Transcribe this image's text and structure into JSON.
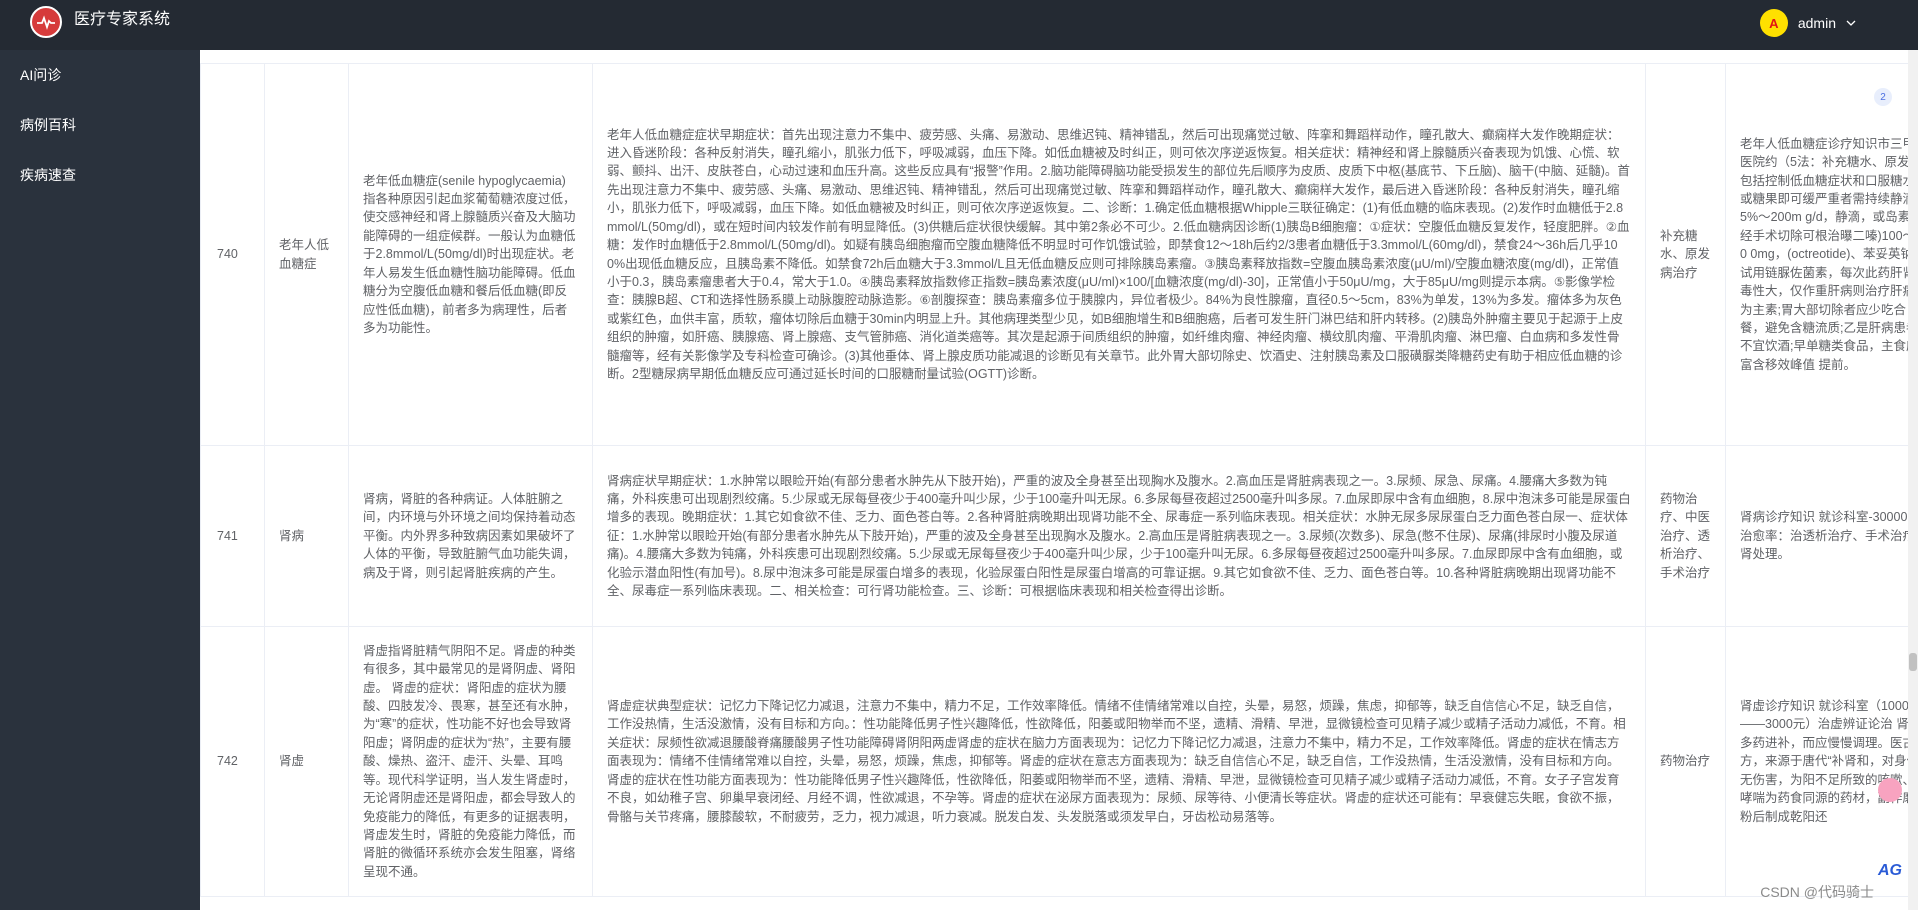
{
  "header": {
    "brand": "医疗专家系统",
    "avatar_letter": "A",
    "username": "admin",
    "chevron": "chevron-down-icon"
  },
  "sidebar": {
    "items": [
      {
        "label": "AI问诊"
      },
      {
        "label": "病例百科"
      },
      {
        "label": "疾病速查"
      }
    ]
  },
  "rows": [
    {
      "id": "740",
      "name": "老年人低血糖症",
      "desc": "老年低血糖症(senile hypoglycaemia)指各种原因引起血浆葡萄糖浓度过低，使交感神经和肾上腺髓质兴奋及大脑功能障碍的一组症候群。一般认为血糖低于2.8mmol/L(50mg/dl)时出现症状。老年人易发生低血糖性脑功能障碍。低血糖分为空腹低血糖和餐后低血糖(即反应性低血糖)，前者多为病理性，后者多为功能性。",
      "symptom": "老年人低血糖症症状早期症状：首先出现注意力不集中、疲劳感、头痛、易激动、思维迟钝、精神错乱，然后可出现痛觉过敏、阵挛和舞蹈样动作，瞳孔散大、癫痫样大发作晚期症状：进入昏迷阶段：各种反射消失，瞳孔缩小，肌张力低下，呼吸减弱，血压下降。如低血糖被及时纠正，则可依次序逆返恢复。相关症状：精神经和肾上腺髓质兴奋表现为饥饿、心慌、软弱、颤抖、出汗、皮肤苍白，心动过速和血压升高。这些反应具有“报警”作用。2.脑功能障碍脑功能受损发生的部位先后顺序为皮质、皮质下中枢(基底节、下丘脑)、脑干(中脑、延髓)。首先出现注意力不集中、疲劳感、头痛、易激动、思维迟钝、精神错乱，然后可出现痛觉过敏、阵挛和舞蹈样动作，瞳孔散大、癫痫样大发作，最后进入昏迷阶段：各种反射消失，瞳孔缩小，肌张力低下，呼吸减弱，血压下降。如低血糖被及时纠正，则可依次序逆返恢复。二、诊断：1.确定低血糖根据Whipple三联征确定：(1)有低血糖的临床表现。(2)发作时血糖低于2.8mmol/L(50mg/dl)，或在短时间内较发作前有明显降低。(3)供糖后症状很快缓解。其中第2条必不可少。2.低血糖病因诊断(1)胰岛B细胞瘤：①症状：空腹低血糖反复发作，轻度肥胖。②血糖：发作时血糖低于2.8mmol/L(50mg/dl)。如疑有胰岛细胞瘤而空腹血糖降低不明显时可作饥饿试验，即禁食12～18h后约2/3患者血糖低于3.3mmol/L(60mg/dl)，禁食24～36h后几乎100%出现低血糖反应，且胰岛素不降低。如禁食72h后血糖大于3.3mmol/L且无低血糖反应则可排除胰岛素瘤。③胰岛素释放指数=空腹血胰岛素浓度(μU/ml)/空腹血糖浓度(mg/dl)，正常值小于0.3，胰岛素瘤患者大于0.4，常大于1.0。④胰岛素释放指数修正指数=胰岛素浓度(μU/ml)×100/[血糖浓度(mg/dl)-30]，正常值小于50μU/mg，大于85μU/mg则提示本病。⑤影像学检查：胰腺B超、CT和选择性肠系膜上动脉腹腔动脉造影。⑥剖腹探查：胰岛素瘤多位于胰腺内，异位者极少。84%为良性腺瘤，直径0.5～5cm，83%为单发，13%为多发。瘤体多为灰色或紫红色，血供丰富，质软，瘤体切除后血糖于30min内明显上升。其他病理类型少见，如B细胞增生和B细胞癌，后者可发生肝门淋巴结和肝内转移。(2)胰岛外肿瘤主要见于起源于上皮组织的肿瘤，如肝癌、胰腺癌、肾上腺癌、支气管肺癌、消化道类癌等。其次是起源于间质组织的肿瘤，如纤维肉瘤、神经肉瘤、横纹肌肉瘤、平滑肌肉瘤、淋巴瘤、白血病和多发性骨髓瘤等，经有关影像学及专科检查可确诊。(3)其他垂体、肾上腺皮质功能减退的诊断见有关章节。此外胃大部切除史、饮酒史、注射胰岛素及口服磺脲类降糖药史有助于相应低血糖的诊断。2型糖尿病早期低血糖反应可通过延长时间的口服糖耐量试验(OGTT)诊断。",
      "treat": "补充糖水、原发病治疗",
      "detail": "老年人低血糖症诊疗知识市三甲医院约（5法：补充糖水、原发病包括控制低血糖症状和口服糖水或糖果即可缓严重者需持续静滴5%～200m g/d，静滴，或岛素瘤经手术切除可根治曝二嗪)100～20 0mg，(octreotide)、苯妥英钠可试用链脲佐菌素，每次此药肝肾毒性大，仅作重肝病则治疗肝病为主素;胃大部切除者应少吃合餐，避免含糖流质;乙是肝病患者不宜饮酒;早单糖类食品，主食应富含移效峰值 提前。"
    },
    {
      "id": "741",
      "name": "肾病",
      "desc": "肾病，肾脏的各种病证。人体脏腑之间，内环境与外环境之间均保持着动态平衡。内外界多种致病因素如果破坏了人体的平衡，导致脏腑气血功能失调，病及于肾，则引起肾脏疾病的产生。",
      "symptom": "肾病症状早期症状：1.水肿常以眼睑开始(有部分患者水肿先从下肢开始)，严重的波及全身甚至出现胸水及腹水。2.高血压是肾脏病表现之一。3.尿频、尿急、尿痛。4.腰痛大多数为钝痛，外科疾患可出现剧烈绞痛。5.少尿或无尿每昼夜少于400毫升叫少尿，少于100毫升叫无尿。6.多尿每昼夜超过2500毫升叫多尿。7.血尿即尿中含有血细胞，8.尿中泡沫多可能是尿蛋白增多的表现。晚期症状：1.其它如食欲不佳、乏力、面色苍白等。2.各种肾脏病晚期出现肾功能不全、尿毒症一系列临床表现。相关症状：水肿无尿多尿尿蛋白乏力面色苍白尿一、症状体征：1.水肿常以眼睑开始(有部分患者水肿先从下肢开始)，严重的波及全身甚至出现胸水及腹水。2.高血压是肾脏病表现之一。3.尿频(次数多)、尿急(憋不住尿)、尿痛(排尿时小腹及尿道痛)。4.腰痛大多数为钝痛，外科疾患可出现剧烈绞痛。5.少尿或无尿每昼夜少于400毫升叫少尿，少于100毫升叫无尿。6.多尿每昼夜超过2500毫升叫多尿。7.血尿即尿中含有血细胞，或化验示潜血阳性(有加号)。8.尿中泡沫多可能是尿蛋白增多的表现，化验尿蛋白阳性是尿蛋白增高的可靠证据。9.其它如食欲不佳、乏力、面色苍白等。10.各种肾脏病晚期出现肾功能不全、尿毒症一系列临床表现。二、相关检查：可行肾功能检查。三、诊断：可根据临床表现和相关检查得出诊断。",
      "treat": "药物治疗、中医治疗、透析治疗、手术治疗",
      "detail": "肾病诊疗知识 就诊科室-30000元)治愈率：治透析治疗、手术治疗 肾处理。"
    },
    {
      "id": "742",
      "name": "肾虚",
      "desc": "肾虚指肾脏精气阴阳不足。肾虚的种类有很多，其中最常见的是肾阴虚、肾阳虚。 肾虚的症状：肾阳虚的症状为腰酸、四肢发冷、畏寒，甚至还有水肿，为“寒”的症状，性功能不好也会导致肾阳虚；肾阴虚的症状为“热”，主要有腰酸、燥热、盗汗、虚汗、头晕、耳鸣等。现代科学证明，当人发生肾虚时，无论肾阴虚还是肾阳虚，都会导致人的免疫能力的降低，有更多的证据表明，肾虚发生时，肾脏的免疫能力降低，而肾脏的微循环系统亦会发生阻塞，肾络呈现不通。",
      "symptom": "肾虚症状典型症状：记忆力下降记忆力减退，注意力不集中，精力不足，工作效率降低。情绪不佳情绪常难以自控，头晕，易怒，烦躁，焦虑，抑郁等，缺乏自信信心不足，缺乏自信，工作没热情，生活没激情，没有目标和方向。：性功能降低男子性兴趣降低，性欲降低，阳萎或阳物举而不坚，遗精、滑精、早泄，显微镜检查可见精子减少或精子活动力减低，不育。相关症状：尿频性欲减退腰酸脊痛腰酸男子性功能障碍肾阴阳两虚肾虚的症状在脑力方面表现为：记忆力下降记忆力减退，注意力不集中，精力不足，工作效率降低。肾虚的症状在情志方面表现为：情绪不佳情绪常难以自控，头晕，易怒，烦躁，焦虑，抑郁等。肾虚的症状在意志方面表现为：缺乏自信信心不足，缺乏自信，工作没热情，生活没激情，没有目标和方向。肾虚的症状在性功能方面表现为：性功能降低男子性兴趣降低，性欲降低，阳萎或阳物举而不坚，遗精、滑精、早泄，显微镜检查可见精子减少或精子活动力减低，不育。女子子宫发育不良，如幼稚子宫、卵巢早衰闭经、月经不调，性欲减退，不孕等。肾虚的症状在泌尿方面表现为：尿频、尿等待、小便清长等症状。肾虚的症状还可能有：早衰健忘失眠，食欲不振，骨骼与关节疼痛，腰膝酸软，不耐疲劳，乏力，视力减退，听力衰减。脱发白发、头发脱落或须发早白，牙齿松动易落等。",
      "treat": "药物治疗",
      "detail": "肾虚诊疗知识 就诊科室（1000——3000元）治虚辨证论治 肾虚多药进补，而应慢慢调理。医古方，来源于唐代“补肾和，对身体无伤害，为阳不足所致的咳嗽、哮喘为药食同源的药材，副作磨粉后制成乾阳还"
    }
  ],
  "watermark": "CSDN @代码骑士",
  "float_badge": "2",
  "ag_mark": "AG"
}
